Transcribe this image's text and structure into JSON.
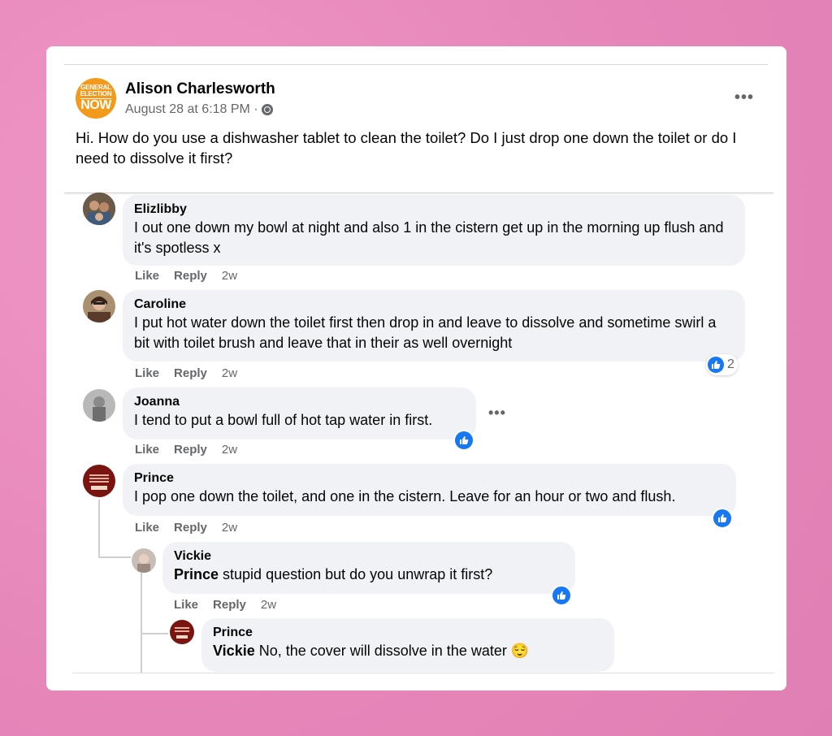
{
  "post": {
    "avatar_text": [
      "GENERAL",
      "ELECTION",
      "NOW"
    ],
    "author": "Alison Charlesworth",
    "timestamp": "August 28 at 6:18 PM ·",
    "audience_icon": "group-icon",
    "text": "Hi. How do you use a dishwasher tablet to clean the toilet? Do I just drop one down the toilet or do I need to dissolve it first?"
  },
  "actions": {
    "like": "Like",
    "reply": "Reply"
  },
  "comments": [
    {
      "name": "Elizlibby",
      "text": "I out one down my bowl at night and also 1 in the cistern get up in the morning up flush and it's spotless x",
      "time": "2w"
    },
    {
      "name": "Caroline",
      "text": "I put hot water down the toilet first then drop in and leave to dissolve and sometime swirl a bit with toilet brush and leave that in their as well overnight",
      "time": "2w",
      "reactions": "2"
    },
    {
      "name": "Joanna",
      "text": "I tend to put a bowl full of hot tap water in first.",
      "time": "2w"
    },
    {
      "name": "Prince",
      "text": "I pop one down the toilet, and one in the cistern. Leave for an hour or two and flush.",
      "time": "2w",
      "replies": [
        {
          "name": "Vickie",
          "tag": "Prince",
          "text": " stupid question but do you unwrap it first?",
          "time": "2w",
          "replies": [
            {
              "name": "Prince",
              "tag": "Vickie",
              "text": " No, the cover will dissolve in the water 😌"
            }
          ]
        }
      ]
    }
  ],
  "colors": {
    "background": "#e98bbd",
    "bubble": "#f0f2f5",
    "like_blue": "#1877f2",
    "muted": "#65676b"
  }
}
